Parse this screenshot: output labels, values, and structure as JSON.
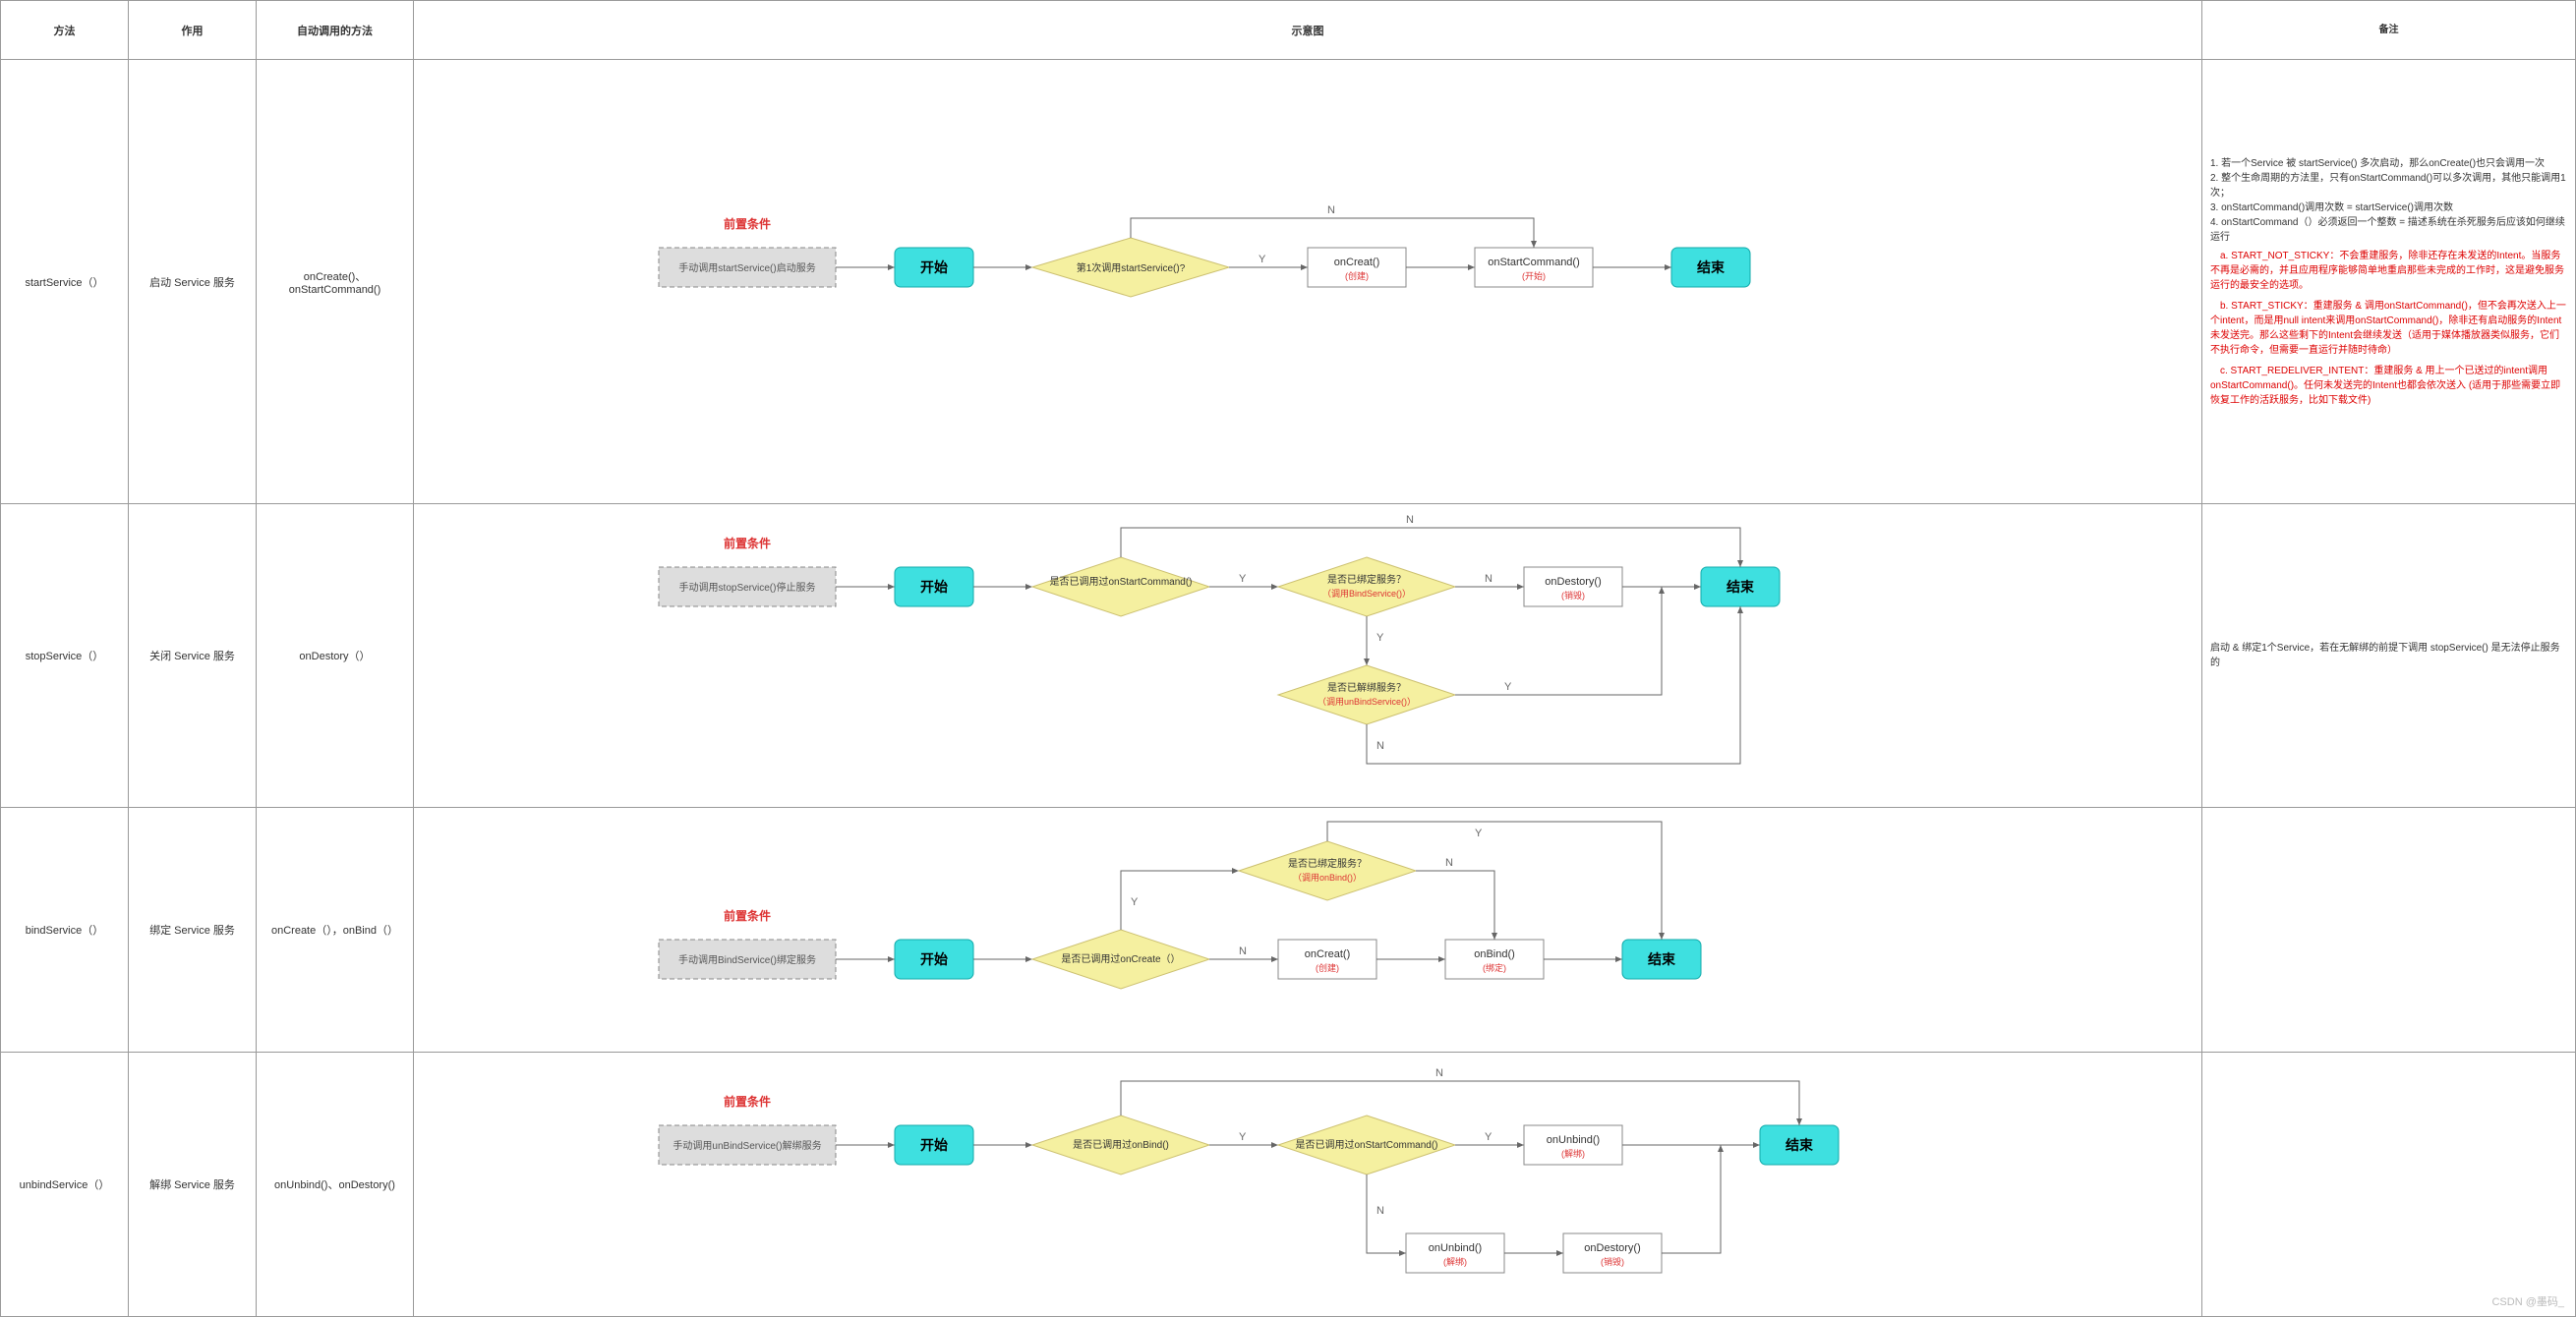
{
  "headers": {
    "method": "方法",
    "role": "作用",
    "auto": "自动调用的方法",
    "diagram": "示意图",
    "notes": "备注"
  },
  "rows": [
    {
      "method": "startService（）",
      "role": "启动 Service 服务",
      "auto": "onCreate()、onStartCommand()",
      "pre_label": "前置条件",
      "dash": "手动调用startService()启动服务",
      "start": "开始",
      "end": "结束",
      "d1": "第1次调用startService()?",
      "p1": "onCreat()",
      "p1s": "(创建)",
      "p2": "onStartCommand()",
      "p2s": "(开始)",
      "y": "Y",
      "n": "N"
    },
    {
      "method": "stopService（）",
      "role": "关闭 Service 服务",
      "auto": "onDestory（）",
      "pre_label": "前置条件",
      "dash": "手动调用stopService()停止服务",
      "start": "开始",
      "end": "结束",
      "d1": "是否已调用过onStartCommand()",
      "d2": "是否已绑定服务？",
      "d2s": "（调用BindService()）",
      "d3": "是否已解绑服务？",
      "d3s": "（调用unBindService()）",
      "p1": "onDestory()",
      "p1s": "(销毁)",
      "y": "Y",
      "n": "N"
    },
    {
      "method": "bindService（）",
      "role": "绑定 Service 服务",
      "auto": "onCreate（），onBind（）",
      "pre_label": "前置条件",
      "dash": "手动调用BindService()绑定服务",
      "start": "开始",
      "end": "结束",
      "d1": "是否已调用过onCreate（）",
      "d2": "是否已绑定服务？",
      "d2s": "（调用onBind()）",
      "p1": "onCreat()",
      "p1s": "(创建)",
      "p2": "onBind()",
      "p2s": "(绑定)",
      "y": "Y",
      "n": "N"
    },
    {
      "method": "unbindService（）",
      "role": "解绑 Service 服务",
      "auto": "onUnbind()、onDestory()",
      "pre_label": "前置条件",
      "dash": "手动调用unBindService()解绑服务",
      "start": "开始",
      "end": "结束",
      "d1": "是否已调用过onBind()",
      "d2": "是否已调用过onStartCommand()",
      "p1": "onUnbind()",
      "p1s": "(解绑)",
      "p2": "onUnbind()",
      "p2s": "(解绑)",
      "p3": "onDestory()",
      "p3s": "(销毁)",
      "y": "Y",
      "n": "N"
    }
  ],
  "notes": {
    "n1": "1. 若一个Service 被 startService() 多次启动，那么onCreate()也只会调用一次",
    "n2": "2. 整个生命周期的方法里，只有onStartCommand()可以多次调用，其他只能调用1次；",
    "n3": "3. onStartCommand()调用次数 = startService()调用次数",
    "n4": "4. onStartCommand（）必须返回一个整数 = 描述系统在杀死服务后应该如何继续运行",
    "na": "a. START_NOT_STICKY：不会重建服务，除非还存在未发送的Intent。当服务不再是必需的，并且应用程序能够简单地重启那些未完成的工作时，这是避免服务运行的最安全的选项。",
    "nb": "b. START_STICKY：重建服务 & 调用onStartCommand()，但不会再次送入上一个intent，而是用null intent来调用onStartCommand()，除非还有启动服务的Intent未发送完。那么这些剩下的Intent会继续发送（适用于媒体播放器类似服务，它们不执行命令，但需要一直运行并随时待命）",
    "nc": "c. START_REDELIVER_INTENT：重建服务 & 用上一个已送过的intent调用onStartCommand()。任何未发送完的Intent也都会依次送入 (适用于那些需要立即恢复工作的活跃服务，比如下载文件)",
    "r2": "启动 & 绑定1个Service，若在无解绑的前提下调用 stopService() 是无法停止服务的"
  },
  "watermark": "CSDN @墨码_"
}
